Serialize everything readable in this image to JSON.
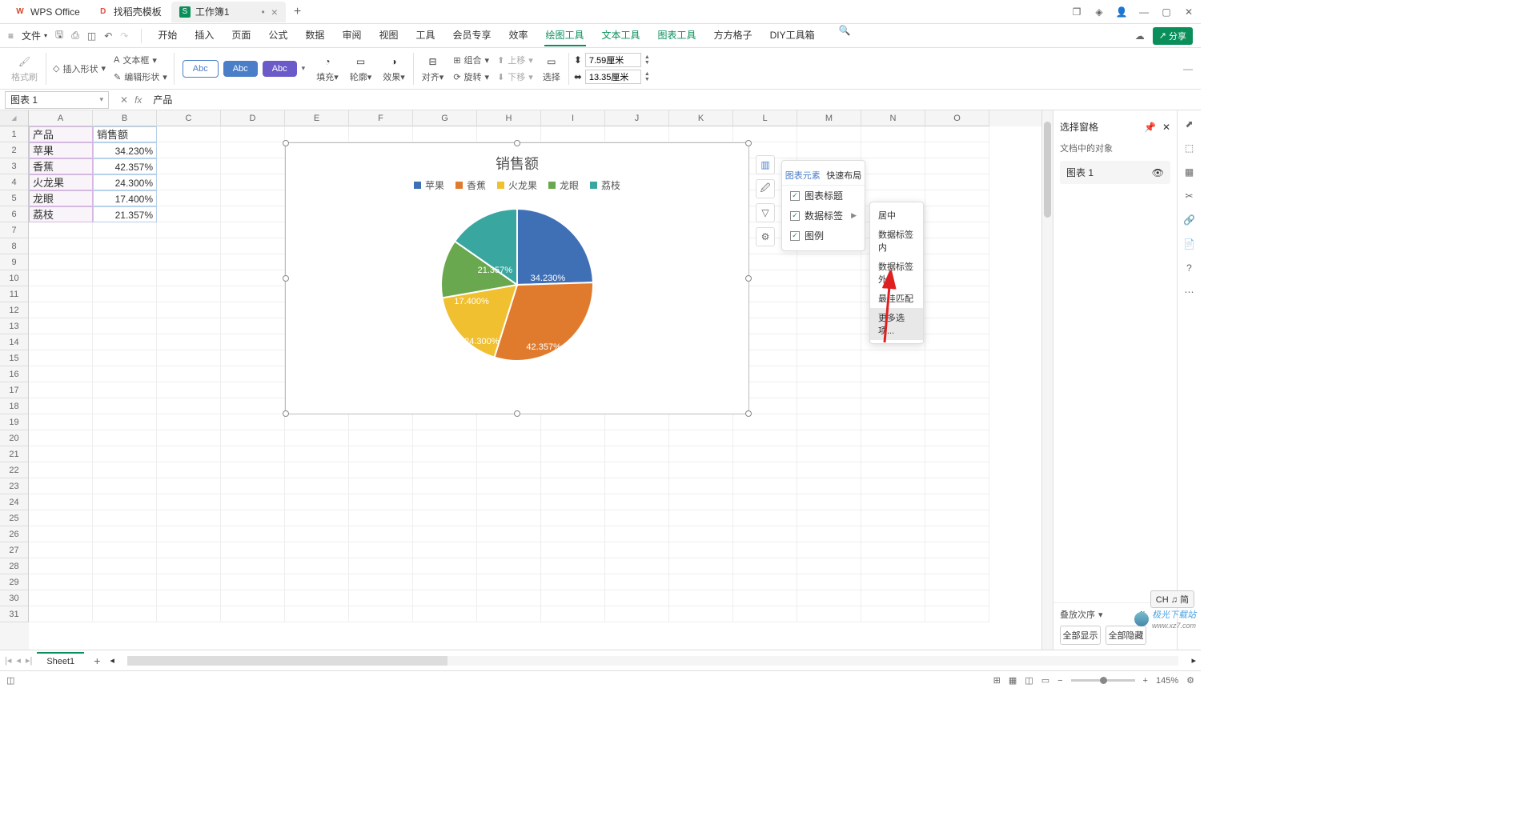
{
  "titlebar": {
    "tabs": [
      {
        "icon": "W",
        "iconColor": "#d24726",
        "label": "WPS Office"
      },
      {
        "icon": "D",
        "iconColor": "#e74c3c",
        "label": "找稻壳模板"
      },
      {
        "icon": "S",
        "iconColor": "#0a8f5b",
        "label": "工作簿1",
        "active": true,
        "dirty": "•"
      }
    ]
  },
  "menubar": {
    "file": "文件",
    "tabs": [
      "开始",
      "插入",
      "页面",
      "公式",
      "数据",
      "审阅",
      "视图",
      "工具",
      "会员专享",
      "效率",
      "绘图工具",
      "文本工具",
      "图表工具",
      "方方格子",
      "DIY工具箱"
    ],
    "active": "绘图工具",
    "share": "分享"
  },
  "ribbon": {
    "fmtBrush": "格式刷",
    "insertShape": "插入形状",
    "textBox": "文本框",
    "editShape": "编辑形状",
    "abc": "Abc",
    "fill": "填充",
    "outline": "轮廓",
    "effect": "效果",
    "align": "对齐",
    "group": "组合",
    "rotate": "旋转",
    "moveUp": "上移",
    "moveDown": "下移",
    "select": "选择",
    "height": "7.59厘米",
    "width": "13.35厘米"
  },
  "nameBox": "图表 1",
  "formula": "产品",
  "columns": [
    "A",
    "B",
    "C",
    "D",
    "E",
    "F",
    "G",
    "H",
    "I",
    "J",
    "K",
    "L",
    "M",
    "N",
    "O"
  ],
  "rows": [
    "1",
    "2",
    "3",
    "4",
    "5",
    "6",
    "7",
    "8",
    "9",
    "10",
    "11",
    "12",
    "13",
    "14",
    "15",
    "16",
    "17",
    "18",
    "19",
    "20",
    "21",
    "22",
    "23",
    "24",
    "25",
    "26",
    "27",
    "28",
    "29",
    "30",
    "31"
  ],
  "table": {
    "header": [
      "产品",
      "销售额"
    ],
    "rows": [
      [
        "苹果",
        "34.230%"
      ],
      [
        "香蕉",
        "42.357%"
      ],
      [
        "火龙果",
        "24.300%"
      ],
      [
        "龙眼",
        "17.400%"
      ],
      [
        "荔枝",
        "21.357%"
      ]
    ]
  },
  "chart_data": {
    "type": "pie",
    "title": "销售额",
    "series": [
      {
        "name": "苹果",
        "value": 34.23,
        "label": "34.230%",
        "color": "#3f6fb5"
      },
      {
        "name": "香蕉",
        "value": 42.357,
        "label": "42.357%",
        "color": "#e07b2e"
      },
      {
        "name": "火龙果",
        "value": 24.3,
        "label": "24.300%",
        "color": "#f0c030"
      },
      {
        "name": "龙眼",
        "value": 17.4,
        "label": "17.400%",
        "color": "#6aa84f"
      },
      {
        "name": "荔枝",
        "value": 21.357,
        "label": "21.357%",
        "color": "#3aa6a0"
      }
    ]
  },
  "popup1": {
    "tab1": "图表元素",
    "tab2": "快速布局",
    "items": [
      "图表标题",
      "数据标签",
      "图例"
    ]
  },
  "popup2": {
    "items": [
      "居中",
      "数据标签内",
      "数据标签外",
      "最佳匹配",
      "更多选项..."
    ]
  },
  "rightPanel": {
    "title": "选择窗格",
    "sub": "文档中的对象",
    "item": "图表 1",
    "dep": "叠放次序",
    "showAll": "全部显示",
    "hideAll": "全部隐藏"
  },
  "sheetTab": "Sheet1",
  "status": {
    "zoom": "145%",
    "ime": "CH ♫ 简"
  },
  "watermark": {
    "text": "极光下载站",
    "url": "www.xz7.com"
  }
}
